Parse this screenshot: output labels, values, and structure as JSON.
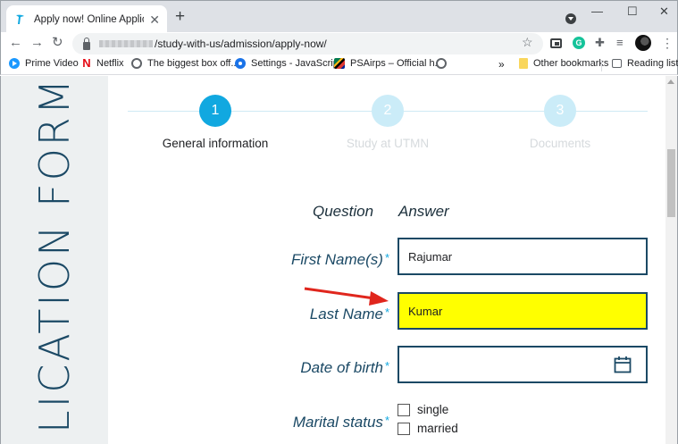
{
  "browser": {
    "tab": {
      "title": "Apply now! Online Application Fo"
    },
    "url": {
      "path": "/study-with-us/admission/apply-now/"
    },
    "bookmarks": {
      "items": [
        {
          "label": "Prime Video"
        },
        {
          "label": "Netflix"
        },
        {
          "label": "The biggest box off..."
        },
        {
          "label": "Settings - JavaScript"
        },
        {
          "label": "PSAirps – Official h..."
        }
      ],
      "overflow": "»",
      "other": "Other bookmarks",
      "reading_list": "Reading list"
    }
  },
  "page": {
    "vertical_title": "LICATION FORM",
    "steps": [
      {
        "number": "1",
        "label": "General information",
        "active": true
      },
      {
        "number": "2",
        "label": "Study at UTMN",
        "active": false
      },
      {
        "number": "3",
        "label": "Documents",
        "active": false
      }
    ],
    "columns": {
      "question": "Question",
      "answer": "Answer"
    },
    "fields": {
      "first_name": {
        "label": "First Name(s)",
        "required": "*",
        "value": "Rajumar"
      },
      "last_name": {
        "label": "Last Name",
        "required": "*",
        "value": "Kumar",
        "highlight": "#ffff00"
      },
      "dob": {
        "label": "Date of birth",
        "required": "*",
        "value": ""
      },
      "marital": {
        "label": "Marital status",
        "required": "*",
        "options": [
          "single",
          "married"
        ]
      }
    }
  },
  "colors": {
    "accent": "#11a8e0",
    "primary_text": "#1b4965",
    "annotation_arrow": "#e0261d"
  }
}
